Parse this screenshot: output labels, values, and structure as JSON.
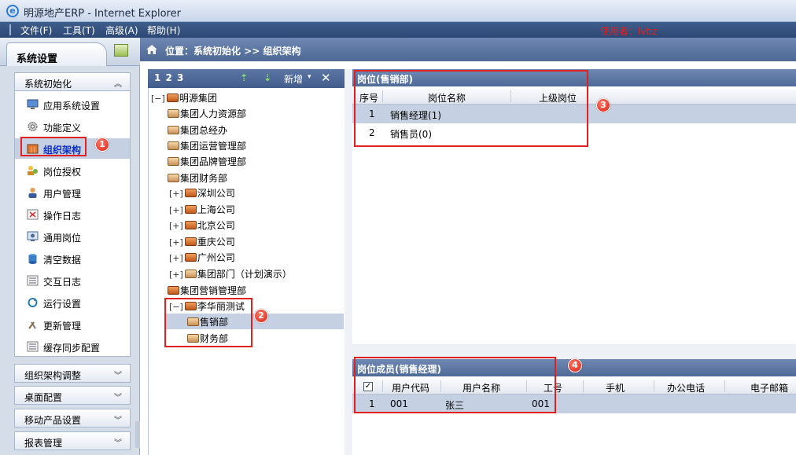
{
  "window": {
    "title": "明源地产ERP - Internet Explorer"
  },
  "menu": {
    "items": [
      "文件(F)",
      "工具(T)",
      "高级(A)",
      "帮助(H)"
    ],
    "user_label": "使用者：lvbz"
  },
  "left_panel": {
    "tab_title": "系统设置",
    "sections": {
      "system_init": "系统初始化",
      "org_adjust": "组织架构调整",
      "desktop": "桌面配置",
      "mobile": "移动产品设置",
      "report": "报表管理"
    },
    "items": [
      {
        "label": "应用系统设置",
        "icon": "monitor-icon"
      },
      {
        "label": "功能定义",
        "icon": "gear-icon"
      },
      {
        "label": "组织架构",
        "icon": "org-building-icon",
        "selected": true
      },
      {
        "label": "岗位授权",
        "icon": "users-key-icon"
      },
      {
        "label": "用户管理",
        "icon": "user-icon"
      },
      {
        "label": "操作日志",
        "icon": "log-icon"
      },
      {
        "label": "通用岗位",
        "icon": "badge-icon"
      },
      {
        "label": "清空数据",
        "icon": "database-icon"
      },
      {
        "label": "交互日志",
        "icon": "list-icon"
      },
      {
        "label": "运行设置",
        "icon": "refresh-icon"
      },
      {
        "label": "更新管理",
        "icon": "tools-icon"
      },
      {
        "label": "缓存同步配置",
        "icon": "list-icon"
      }
    ]
  },
  "breadcrumb": {
    "text": "位置：系统初始化 >> 组织架构"
  },
  "tree": {
    "toolbar": {
      "levels": "1 2 3",
      "new_label": "新增"
    },
    "nodes": [
      {
        "label": "明源集团",
        "exp": "[−]",
        "type": "org"
      },
      {
        "label": "集团人力资源部",
        "exp": "",
        "type": "dept"
      },
      {
        "label": "集团总经办",
        "exp": "",
        "type": "dept"
      },
      {
        "label": "集团运营管理部",
        "exp": "",
        "type": "dept"
      },
      {
        "label": "集团品牌管理部",
        "exp": "",
        "type": "dept"
      },
      {
        "label": "集团财务部",
        "exp": "",
        "type": "dept"
      },
      {
        "label": "深圳公司",
        "exp": "[+]",
        "type": "org"
      },
      {
        "label": "上海公司",
        "exp": "[+]",
        "type": "org"
      },
      {
        "label": "北京公司",
        "exp": "[+]",
        "type": "org"
      },
      {
        "label": "重庆公司",
        "exp": "[+]",
        "type": "org"
      },
      {
        "label": "广州公司",
        "exp": "[+]",
        "type": "org"
      },
      {
        "label": "集团部门（计划演示）",
        "exp": "[+]",
        "type": "dept"
      },
      {
        "label": "集团营销管理部",
        "exp": "",
        "type": "org"
      },
      {
        "label": "李华丽测试",
        "exp": "[−]",
        "type": "org"
      },
      {
        "label": "售销部",
        "exp": "",
        "type": "dept",
        "selected": true
      },
      {
        "label": "财务部",
        "exp": "",
        "type": "dept"
      }
    ]
  },
  "positions": {
    "header": "岗位(售销部)",
    "columns": [
      "序号",
      "岗位名称",
      "上级岗位"
    ],
    "rows": [
      {
        "no": "1",
        "name": "销售经理(1)",
        "parent": ""
      },
      {
        "no": "2",
        "name": "销售员(0)",
        "parent": ""
      }
    ]
  },
  "members": {
    "header": "岗位成员(销售经理)",
    "columns": [
      "用户代码",
      "用户名称",
      "工号",
      "手机",
      "办公电话",
      "电子邮箱"
    ],
    "rows": [
      {
        "no": "1",
        "code": "001",
        "name": "张三",
        "emp_no": "001"
      }
    ]
  },
  "badges": [
    "1",
    "2",
    "3",
    "4"
  ],
  "colors": {
    "accent": "#4f6a97",
    "highlight_box": "#e22020",
    "selected_row": "#c5d1e3"
  }
}
